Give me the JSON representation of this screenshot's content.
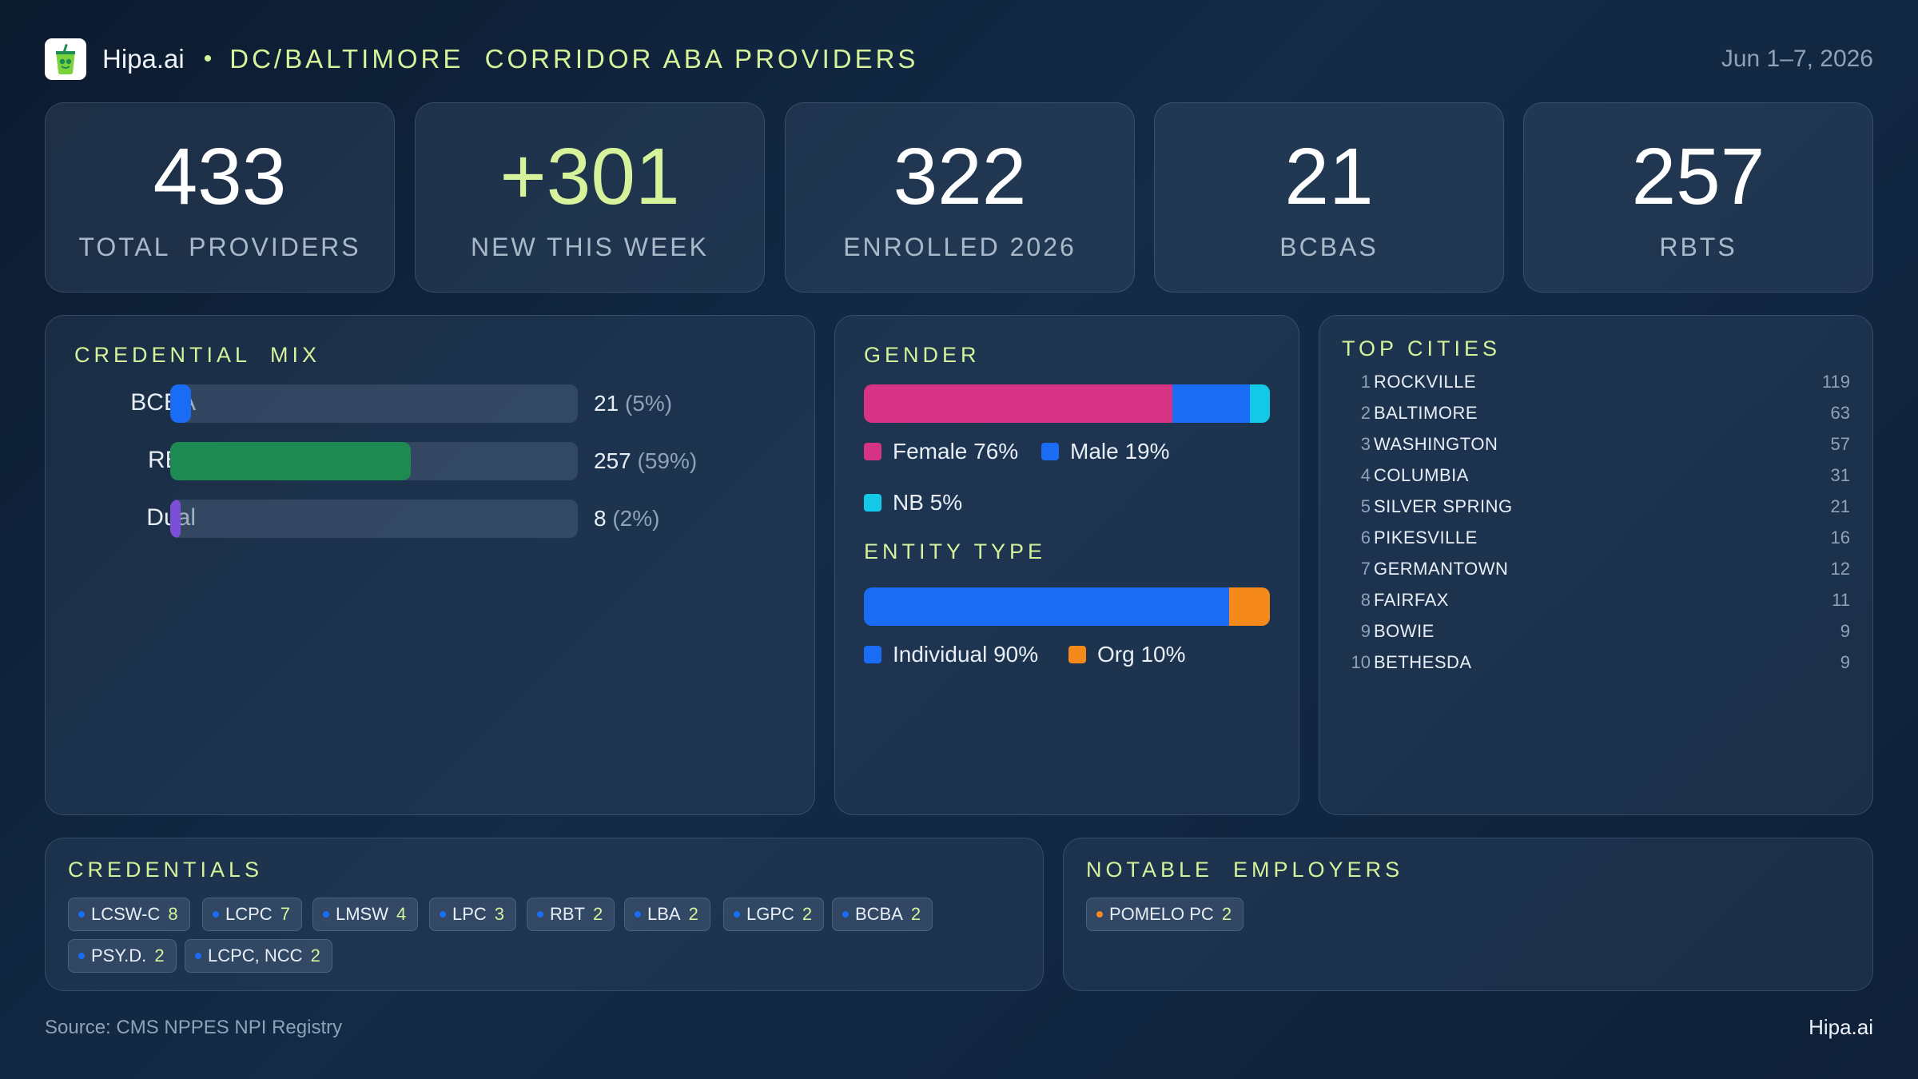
{
  "header": {
    "logo_icon": "soda-cup-icon",
    "brand": "Hipa.ai",
    "bullet": "•",
    "title": "DC/BALTIMORE  CORRIDOR ABA PROVIDERS",
    "date_range": "Jun 1–7, 2026"
  },
  "kpis": [
    {
      "value": "433",
      "label": "TOTAL  PROVIDERS"
    },
    {
      "value": "+301",
      "label": "NEW THIS WEEK"
    },
    {
      "value": "322",
      "label": "ENROLLED 2026"
    },
    {
      "value": "21",
      "label": "BCBAS"
    },
    {
      "value": "257",
      "label": "RBTS"
    }
  ],
  "credential_mix": {
    "title": "CREDENTIAL  MIX",
    "rows": [
      {
        "label": "BCBA",
        "value": "21",
        "pct": "(5%)",
        "fraction": 0.05,
        "color": "#1a6cf5"
      },
      {
        "label": "RBT",
        "value": "257",
        "pct": "(59%)",
        "fraction": 0.59,
        "color": "#1d8a52"
      },
      {
        "label": "Dual",
        "value": "8",
        "pct": "(2%)",
        "fraction": 0.02,
        "color": "#7b4fd6"
      }
    ]
  },
  "gender": {
    "title": "GENDER",
    "segments": [
      {
        "label": "Female 76%",
        "fraction": 0.76,
        "color": "#d63384"
      },
      {
        "label": "Male 19%",
        "fraction": 0.19,
        "color": "#1a6cf5"
      },
      {
        "label": "NB 5%",
        "fraction": 0.05,
        "color": "#14c8e8"
      }
    ]
  },
  "entity_type": {
    "title": "ENTITY TYPE",
    "segments": [
      {
        "label": "Individual 90%",
        "fraction": 0.9,
        "color": "#1a6cf5"
      },
      {
        "label": "Org 10%",
        "fraction": 0.1,
        "color": "#f58a1a"
      }
    ]
  },
  "top_cities": {
    "title": "TOP CITIES",
    "rows": [
      {
        "rank": "1",
        "name": "ROCKVILLE",
        "count": "119"
      },
      {
        "rank": "2",
        "name": "BALTIMORE",
        "count": "63"
      },
      {
        "rank": "3",
        "name": "WASHINGTON",
        "count": "57"
      },
      {
        "rank": "4",
        "name": "COLUMBIA",
        "count": "31"
      },
      {
        "rank": "5",
        "name": "SILVER SPRING",
        "count": "21"
      },
      {
        "rank": "6",
        "name": "PIKESVILLE",
        "count": "16"
      },
      {
        "rank": "7",
        "name": "GERMANTOWN",
        "count": "12"
      },
      {
        "rank": "8",
        "name": "FAIRFAX",
        "count": "11"
      },
      {
        "rank": "9",
        "name": "BOWIE",
        "count": "9"
      },
      {
        "rank": "10",
        "name": "BETHESDA",
        "count": "9"
      }
    ]
  },
  "credentials": {
    "title": "CREDENTIALS",
    "dot_color": "#1a6cf5",
    "chips": [
      {
        "name": "LCSW-C",
        "count": "8"
      },
      {
        "name": "LCPC",
        "count": "7"
      },
      {
        "name": "LMSW",
        "count": "4"
      },
      {
        "name": "LPC",
        "count": "3"
      },
      {
        "name": "RBT",
        "count": "2"
      },
      {
        "name": "LBA",
        "count": "2"
      },
      {
        "name": "LGPC",
        "count": "2"
      },
      {
        "name": "BCBA",
        "count": "2"
      },
      {
        "name": "PSY.D.",
        "count": "2"
      },
      {
        "name": "LCPC, NCC",
        "count": "2"
      }
    ]
  },
  "employers": {
    "title": "NOTABLE  EMPLOYERS",
    "dot_color": "#f58a1a",
    "chips": [
      {
        "name": "POMELO PC",
        "count": "2"
      }
    ]
  },
  "footer": {
    "source": "Source: CMS NPPES NPI Registry",
    "brand": "Hipa.ai"
  }
}
